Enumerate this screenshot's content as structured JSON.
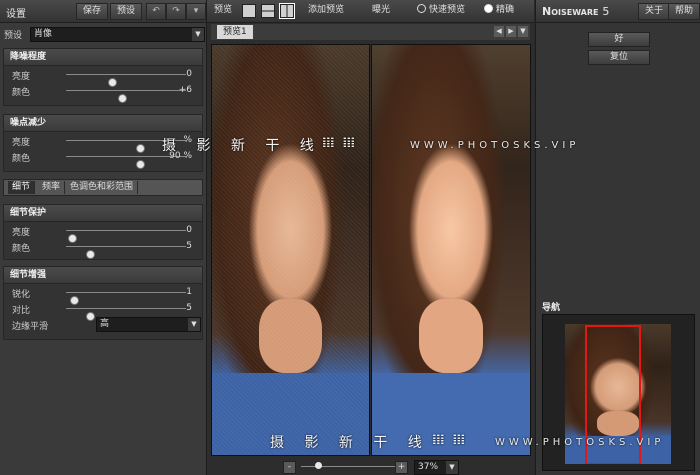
{
  "left": {
    "title": "设置",
    "save": "保存",
    "preview": "预设",
    "preset_label": "预设",
    "preset_value": "肖像",
    "sections": {
      "noise_level": {
        "title": "降噪程度",
        "rows": [
          {
            "label": "亮度",
            "value": "0",
            "pos": 0.38
          },
          {
            "label": "颜色",
            "value": "+6",
            "pos": 0.47
          }
        ]
      },
      "noise_reduction": {
        "title": "噪点减少",
        "rows": [
          {
            "label": "亮度",
            "value": "%",
            "pos": 0.62
          },
          {
            "label": "颜色",
            "value": "90 %",
            "pos": 0.62
          }
        ]
      },
      "detail_protect": {
        "title": "细节保护",
        "rows": [
          {
            "label": "亮度",
            "value": "0",
            "pos": 0.05
          },
          {
            "label": "颜色",
            "value": "5",
            "pos": 0.2
          }
        ]
      },
      "detail_enhance": {
        "title": "细节增强",
        "rows": [
          {
            "label": "锐化",
            "value": "1",
            "pos": 0.07
          },
          {
            "label": "对比",
            "value": "5",
            "pos": 0.2
          }
        ],
        "edge_label": "边缘平滑",
        "edge_value": "高"
      }
    },
    "tabs": [
      "细节",
      "频率",
      "色调色和彩范围"
    ]
  },
  "center": {
    "preview_label": "预览",
    "add_preview": "添加预览",
    "exposure": "曝光",
    "fast_preview": "快速预览",
    "accurate": "精确",
    "preview_tab": "预览1",
    "zoom": "37%"
  },
  "right": {
    "brand_a": "Noiseware",
    "brand_b": "5",
    "about": "关于",
    "help": "帮助",
    "ok": "好",
    "reset": "复位",
    "navigator": "导航"
  },
  "watermark": {
    "cn": "摄 影 新 干 线",
    "logo": "𝍖𝍖",
    "url": "WWW.PHOTOSKS.VIP"
  }
}
